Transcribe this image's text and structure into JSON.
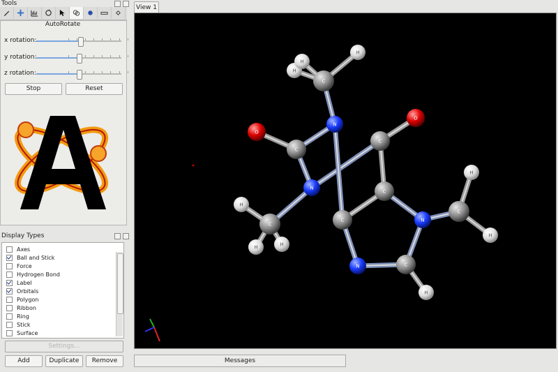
{
  "tools_panel": {
    "title": "Tools",
    "toolbar": [
      "draw-icon",
      "navigate-icon",
      "measure-icon",
      "manipulate-icon",
      "select-icon",
      "autorotate-icon",
      "align-icon",
      "bond-centric-icon",
      "extensions-icon"
    ],
    "autorotate": {
      "title": "AutoRotate",
      "sliders": [
        {
          "label": "x rotation:",
          "value": 0.52
        },
        {
          "label": "y rotation:",
          "value": 0.5
        },
        {
          "label": "z rotation:",
          "value": 0.5
        }
      ],
      "stop_label": "Stop",
      "reset_label": "Reset"
    }
  },
  "display_types": {
    "title": "Display Types",
    "items": [
      {
        "label": "Axes",
        "checked": false
      },
      {
        "label": "Ball and Stick",
        "checked": true
      },
      {
        "label": "Force",
        "checked": false
      },
      {
        "label": "Hydrogen Bond",
        "checked": false
      },
      {
        "label": "Label",
        "checked": true
      },
      {
        "label": "Orbitals",
        "checked": true
      },
      {
        "label": "Polygon",
        "checked": false
      },
      {
        "label": "Ribbon",
        "checked": false
      },
      {
        "label": "Ring",
        "checked": false
      },
      {
        "label": "Stick",
        "checked": false
      },
      {
        "label": "Surface",
        "checked": false
      }
    ],
    "settings_label": "Settings...",
    "add_label": "Add",
    "duplicate_label": "Duplicate",
    "remove_label": "Remove"
  },
  "view": {
    "tab_label": "View 1",
    "messages_label": "Messages"
  },
  "molecule": {
    "atoms": [
      {
        "id": "N1",
        "label": "N",
        "element": "N"
      },
      {
        "id": "N3",
        "label": "N",
        "element": "N"
      },
      {
        "id": "N7",
        "label": "N",
        "element": "N"
      },
      {
        "id": "N9",
        "label": "N",
        "element": "N"
      },
      {
        "id": "C2",
        "label": "C",
        "element": "C"
      },
      {
        "id": "C4",
        "label": "C",
        "element": "C"
      },
      {
        "id": "C5",
        "label": "C",
        "element": "C"
      },
      {
        "id": "C6",
        "label": "C",
        "element": "C"
      },
      {
        "id": "C8",
        "label": "C",
        "element": "C"
      },
      {
        "id": "CM1",
        "label": "C",
        "element": "C"
      },
      {
        "id": "CM3",
        "label": "C",
        "element": "C"
      },
      {
        "id": "CM7",
        "label": "C",
        "element": "C"
      },
      {
        "id": "O2",
        "label": "O",
        "element": "O"
      },
      {
        "id": "O6",
        "label": "O",
        "element": "O"
      },
      {
        "id": "H1a",
        "label": "H",
        "element": "H"
      },
      {
        "id": "H1b",
        "label": "H",
        "element": "H"
      },
      {
        "id": "H1c",
        "label": "H",
        "element": "H"
      },
      {
        "id": "H3a",
        "label": "H",
        "element": "H"
      },
      {
        "id": "H3b",
        "label": "H",
        "element": "H"
      },
      {
        "id": "H3c",
        "label": "H",
        "element": "H"
      },
      {
        "id": "H7a",
        "label": "H",
        "element": "H"
      },
      {
        "id": "H7b",
        "label": "H",
        "element": "H"
      },
      {
        "id": "H8",
        "label": "H",
        "element": "H"
      }
    ],
    "bonds": [
      [
        "CM1",
        "N1"
      ],
      [
        "N1",
        "C2"
      ],
      [
        "N1",
        "C6"
      ],
      [
        "C2",
        "O2"
      ],
      [
        "C2",
        "N3"
      ],
      [
        "N3",
        "CM3"
      ],
      [
        "N3",
        "C4"
      ],
      [
        "C4",
        "C5"
      ],
      [
        "C5",
        "C6"
      ],
      [
        "C6",
        "O6"
      ],
      [
        "C5",
        "N7"
      ],
      [
        "N7",
        "CM7"
      ],
      [
        "N7",
        "C8"
      ],
      [
        "C8",
        "N9"
      ],
      [
        "N9",
        "C4"
      ],
      [
        "C8",
        "H8"
      ],
      [
        "CM1",
        "H1a"
      ],
      [
        "CM1",
        "H1b"
      ],
      [
        "CM1",
        "H1c"
      ],
      [
        "CM3",
        "H3a"
      ],
      [
        "CM3",
        "H3b"
      ],
      [
        "CM3",
        "H3c"
      ],
      [
        "CM7",
        "H7a"
      ],
      [
        "CM7",
        "H7b"
      ]
    ],
    "colors": {
      "C": "#8c8c8c",
      "N": "#1a3cff",
      "O": "#e00000",
      "H": "#f0f0f0"
    }
  }
}
